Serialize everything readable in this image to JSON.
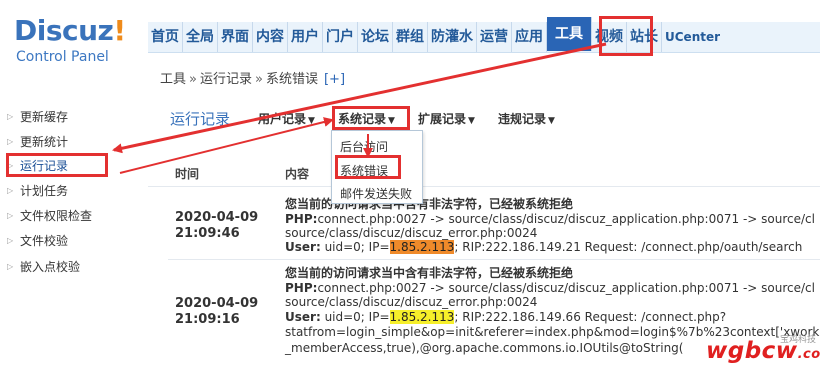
{
  "header": {
    "logo_main": "Discuz",
    "logo_bang": "!",
    "logo_sub": "Control Panel"
  },
  "topnav": [
    "首页",
    "全局",
    "界面",
    "内容",
    "用户",
    "门户",
    "论坛",
    "群组",
    "防灌水",
    "运营",
    "应用",
    "工具",
    "视频",
    "站长",
    "UCenter"
  ],
  "breadcrumb": {
    "part1": "工具",
    "part2": "运行记录",
    "part3": "系统错误",
    "plus": "[+]",
    "sep": "»"
  },
  "sidebar": [
    "更新缓存",
    "更新统计",
    "运行记录",
    "计划任务",
    "文件权限检查",
    "文件校验",
    "嵌入点校验"
  ],
  "main": {
    "subtitle": "运行记录",
    "subnav": [
      "用户记录",
      "系统记录",
      "扩展记录",
      "违规记录"
    ],
    "dropdown": [
      "后台访问",
      "系统错误",
      "邮件发送失败"
    ],
    "col_time": "时间",
    "col_content": "内容"
  },
  "rows": [
    {
      "date": "2020-04-09",
      "time": "21:09:46",
      "msg": "您当前的访问请求当中含有非法字符，已经被系统拒绝",
      "php_label": "PHP:",
      "php_text": "connect.php:0027 -> source/class/discuz/discuz_application.php:0071 -> source/cl",
      "php_text2": "source/class/discuz/discuz_error.php:0024",
      "user_label": "User:",
      "user_pre": " uid=0; IP=",
      "ip": "1.85.2.113",
      "user_post": "; RIP:222.186.149.21 Request: /connect.php/oauth/search"
    },
    {
      "date": "2020-04-09",
      "time": "21:09:16",
      "msg": "您当前的访问请求当中含有非法字符，已经被系统拒绝",
      "php_label": "PHP:",
      "php_text": "connect.php:0027 -> source/class/discuz/discuz_application.php:0071 -> source/cl",
      "php_text2": "source/class/discuz/discuz_error.php:0024",
      "user_label": "User:",
      "user_pre": " uid=0; IP=",
      "ip": "1.85.2.113",
      "user_post": "; RIP:222.186.149.66 Request: /connect.php?",
      "extra1": "statfrom=login_simple&op=init&referer=index.php&mod=login$%7b%23context['xwork",
      "extra2": "_memberAccess,true),@org.apache.commons.io.IOUtils@toString("
    }
  ],
  "watermark": {
    "main": "wgbcw",
    "dom": ".com",
    "sub": "宝鸡科技"
  },
  "colors": {
    "accent": "#2a65b5",
    "annotation": "#e33030",
    "hl_orange": "#ef8a2a",
    "hl_yellow": "#f6ef2a"
  }
}
